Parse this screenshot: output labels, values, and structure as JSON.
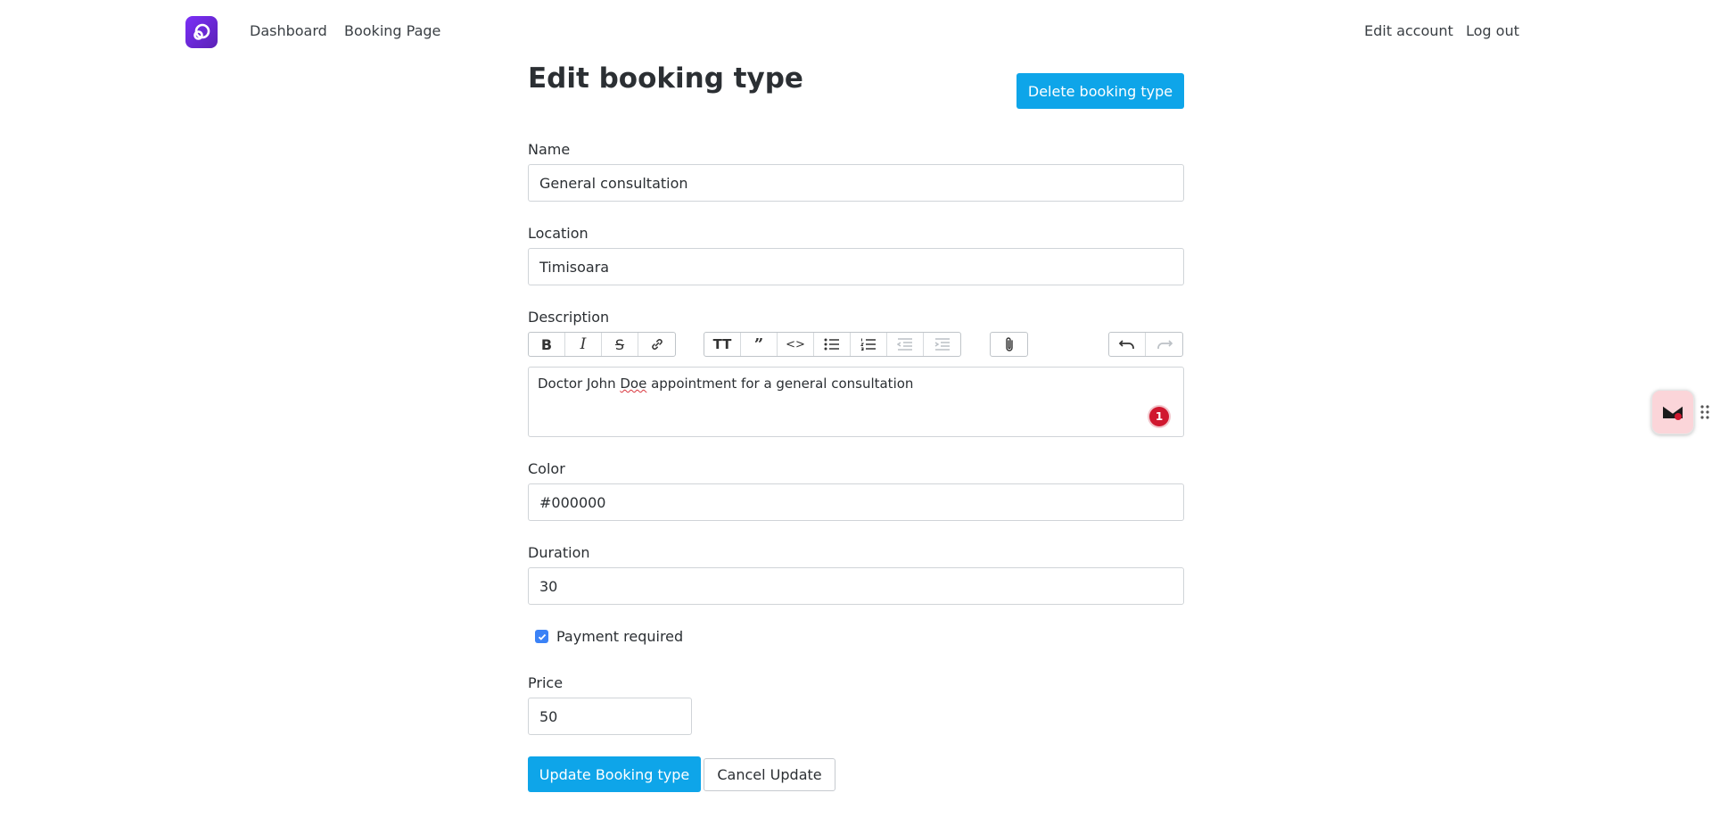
{
  "nav": {
    "links": {
      "dashboard": "Dashboard",
      "booking_page": "Booking Page",
      "edit_account": "Edit account",
      "log_out": "Log out"
    }
  },
  "page": {
    "title": "Edit booking type",
    "delete_label": "Delete booking type"
  },
  "form": {
    "name": {
      "label": "Name",
      "value": "General consultation"
    },
    "location": {
      "label": "Location",
      "value": "Timisoara"
    },
    "description": {
      "label": "Description",
      "text_before": "Doctor John ",
      "misspelled": "Doe",
      "text_after": " appointment for a general consultation",
      "notification_count": "1"
    },
    "color": {
      "label": "Color",
      "value": "#000000"
    },
    "duration": {
      "label": "Duration",
      "value": "30"
    },
    "payment_required": {
      "label": "Payment required",
      "checked": true
    },
    "price": {
      "label": "Price",
      "value": "50"
    },
    "update_label": "Update Booking type",
    "cancel_label": "Cancel Update"
  },
  "toolbar": {
    "text_tools": [
      "bold-icon",
      "italic-icon",
      "strikethrough-icon",
      "link-icon"
    ],
    "block_tools": [
      "heading-icon",
      "quote-icon",
      "code-icon",
      "bullet-list-icon",
      "numbered-list-icon",
      "outdent-icon",
      "indent-icon"
    ],
    "file_tools": [
      "attach-icon"
    ],
    "history_tools": [
      "undo-icon",
      "redo-icon"
    ]
  },
  "colors": {
    "accent": "#0ea5e9",
    "logo": "#6d28d9",
    "checkbox": "#3b82f6",
    "badge": "#d0182f"
  }
}
